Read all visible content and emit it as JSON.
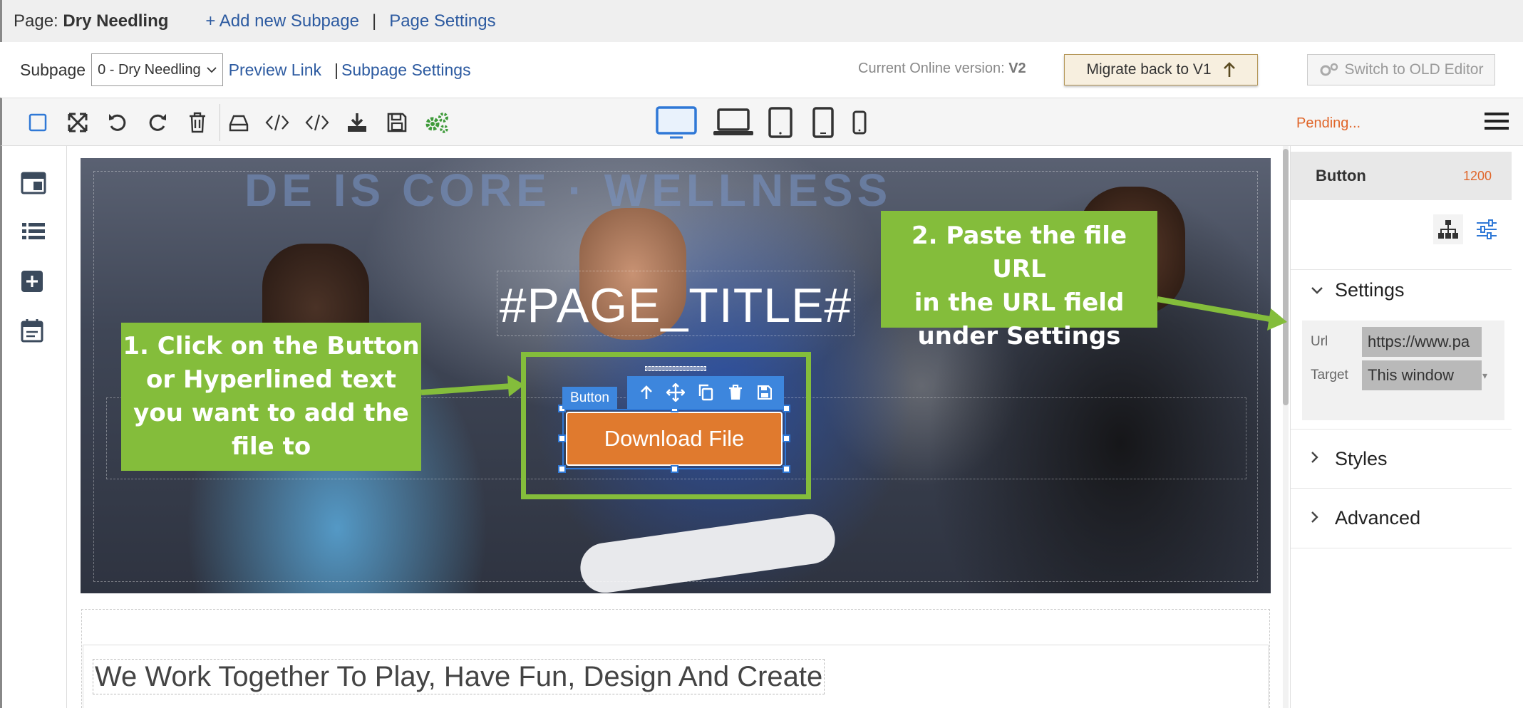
{
  "page_bar": {
    "page_label": "Page:",
    "page_name": "Dry Needling",
    "add_subpage": "+ Add new Subpage",
    "separator": "|",
    "page_settings": "Page Settings"
  },
  "subpage_bar": {
    "subpage_label": "Subpage",
    "subpage_selected": "0 - Dry Needling",
    "preview_link": "Preview Link",
    "pipe": "|",
    "subpage_settings": "Subpage Settings",
    "current_version_label": "Current Online version:",
    "current_version": "V2",
    "migrate_button": "Migrate back to V1",
    "old_editor_button": "Switch to OLD Editor"
  },
  "toolbar": {
    "status": "Pending...",
    "tool_icons": [
      "select-box-icon",
      "fullscreen-icon",
      "undo-icon",
      "redo-icon",
      "trash-icon",
      "drive-icon",
      "code-icon",
      "code-alt-icon",
      "download-icon",
      "save-icon",
      "settings-gears-icon"
    ],
    "device_icons": [
      "desktop-icon",
      "laptop-icon",
      "tablet-icon",
      "tablet-portrait-icon",
      "mobile-icon"
    ],
    "active_device": "desktop-icon"
  },
  "left_rail": {
    "icons": [
      "layout-icon",
      "list-icon",
      "add-block-icon",
      "calendar-icon"
    ]
  },
  "canvas": {
    "hero_sign_text": "DE IS CORE · WELLNESS",
    "page_title": "#PAGE_TITLE#",
    "selected_element_tag": "Button",
    "download_button": "Download File",
    "section_heading": "We Work Together To Play, Have Fun, Design And Create"
  },
  "annotations": {
    "callout_1_lines": [
      "1. Click on the Button",
      "or Hyperlined text",
      "you want to add the",
      "file to"
    ],
    "callout_2_lines": [
      "2. Paste the file URL",
      "in the URL field",
      "under Settings"
    ],
    "highlight_color": "#84bd3b"
  },
  "right_panel": {
    "title": "Button",
    "width_value": "1200",
    "sections": {
      "settings": "Settings",
      "styles": "Styles",
      "advanced": "Advanced"
    },
    "fields": {
      "url_label": "Url",
      "url_value": "https://www.pa",
      "target_label": "Target",
      "target_value": "This window"
    }
  },
  "colors": {
    "accent_blue": "#2f78d6",
    "button_orange": "#e07a2e",
    "pending_orange": "#e0662a",
    "link_blue": "#2c5aa0"
  }
}
